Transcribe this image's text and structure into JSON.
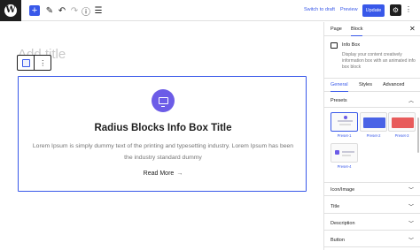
{
  "topbar": {
    "add_icon": "plus-icon",
    "tools": [
      "pencil-icon",
      "undo-icon",
      "redo-icon",
      "info-icon",
      "list-view-icon"
    ],
    "switch_to_draft": "Switch to draft",
    "preview": "Preview",
    "update": "Update"
  },
  "editor": {
    "post_title_placeholder": "Add title",
    "infobox": {
      "title": "Radius Blocks Info Box Title",
      "description": "Lorem Ipsum is simply dummy text of the printing and typesetting industry. Lorem Ipsum has been the industry standard dummy",
      "read_more": "Read More",
      "icon_color": "#6c5ce7"
    }
  },
  "sidebar": {
    "tabs": [
      "Page",
      "Block"
    ],
    "active_tab": "Block",
    "block_name": "Info Box",
    "block_description": "Display your content creatively information box with an animated info box block",
    "subtabs": [
      "General",
      "Styles",
      "Advanced"
    ],
    "active_subtab": "General",
    "presets_label": "Presets",
    "presets": [
      "Preset-1",
      "Preset-2",
      "Preset-3",
      "Preset-4"
    ],
    "panels": [
      "Icon/Image",
      "Title",
      "Description",
      "Button"
    ]
  },
  "colors": {
    "accent": "#3858e9",
    "dark": "#1e1e1e"
  }
}
